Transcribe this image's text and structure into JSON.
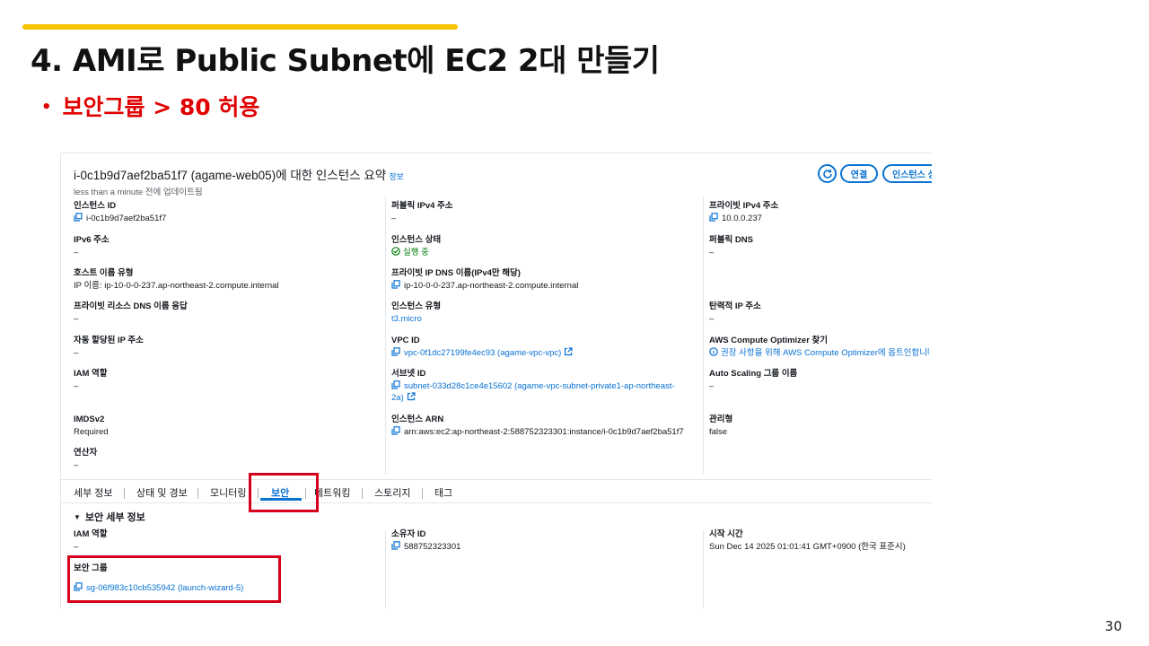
{
  "slide": {
    "title": "4. AMI로 Public Subnet에 EC2 2대 만들기",
    "bullet": "보안그룹 > 80 허용",
    "page_number": "30",
    "colors": {
      "accent_bar": "#f5c400",
      "bullet_text": "#e00000",
      "highlight_box": "#d6001c",
      "aws_link": "#0972d3"
    }
  },
  "summary": {
    "title": "i-0c1b9d7aef2ba51f7 (agame-web05)에 대한 인스턴스 요약",
    "info_link": "정보",
    "updated": "less than a minute 전에 업데이트됨",
    "buttons": {
      "refresh_icon": "refresh-icon",
      "connect": "연결",
      "instance_state": "인스턴스 상"
    }
  },
  "fields": {
    "instance_id": {
      "label": "인스턴스 ID",
      "value": "i-0c1b9d7aef2ba51f7"
    },
    "public_ipv4": {
      "label": "퍼블릭 IPv4 주소",
      "value": "–"
    },
    "private_ipv4": {
      "label": "프라이빗 IPv4 주소",
      "value": "10.0.0.237"
    },
    "ipv6": {
      "label": "IPv6 주소",
      "value": "–"
    },
    "instance_state": {
      "label": "인스턴스 상태",
      "value": "실행 중"
    },
    "public_dns": {
      "label": "퍼블릭 DNS",
      "value": "–"
    },
    "hostname_type": {
      "label": "호스트 이름 유형",
      "value": "IP 이름: ip-10-0-0-237.ap-northeast-2.compute.internal"
    },
    "private_ip_dns": {
      "label": "프라이빗 IP DNS 이름(IPv4만 해당)",
      "value": "ip-10-0-0-237.ap-northeast-2.compute.internal"
    },
    "private_resource_dns": {
      "label": "프라이빗 리소스 DNS 이름 응답",
      "value": "–"
    },
    "instance_type": {
      "label": "인스턴스 유형",
      "value": "t3.micro"
    },
    "elastic_ip": {
      "label": "탄력적 IP 주소",
      "value": "–"
    },
    "auto_ip": {
      "label": "자동 할당된 IP 주소",
      "value": "–"
    },
    "vpc_id": {
      "label": "VPC ID",
      "value": "vpc-0f1dc27199fe4ec93 (agame-vpc-vpc)"
    },
    "compute_optimizer": {
      "label": "AWS Compute Optimizer 찾기",
      "value": "권장 사항을 위해 AWS Compute Optimizer에 옵트인합니다"
    },
    "iam_role": {
      "label": "IAM 역할",
      "value": "–"
    },
    "subnet_id": {
      "label": "서브넷 ID",
      "value_line1": "subnet-033d28c1ce4e15602 (agame-vpc-subnet-private1-ap-northeast-",
      "value_line2": "2a)"
    },
    "auto_scaling": {
      "label": "Auto Scaling 그룹 이름",
      "value": "–"
    },
    "imdsv2": {
      "label": "IMDSv2",
      "value": "Required"
    },
    "instance_arn": {
      "label": "인스턴스 ARN",
      "value": "arn:aws:ec2:ap-northeast-2:588752323301:instance/i-0c1b9d7aef2ba51f7"
    },
    "managed": {
      "label": "관리형",
      "value": "false"
    },
    "operator": {
      "label": "연산자",
      "value": "–"
    }
  },
  "tabs": [
    "세부 정보",
    "상태 및 경보",
    "모니터링",
    "보안",
    "네트워킹",
    "스토리지",
    "태그"
  ],
  "active_tab": "보안",
  "security": {
    "section_title": "보안 세부 정보",
    "iam_role": {
      "label": "IAM 역할",
      "value": "–"
    },
    "owner_id": {
      "label": "소유자 ID",
      "value": "588752323301"
    },
    "launch_time": {
      "label": "시작 시간",
      "value": "Sun Dec 14 2025 01:01:41 GMT+0900 (한국 표준시)"
    },
    "security_groups": {
      "label": "보안 그룹",
      "value": "sg-06f983c10cb535942 (launch-wizard-5)"
    }
  }
}
